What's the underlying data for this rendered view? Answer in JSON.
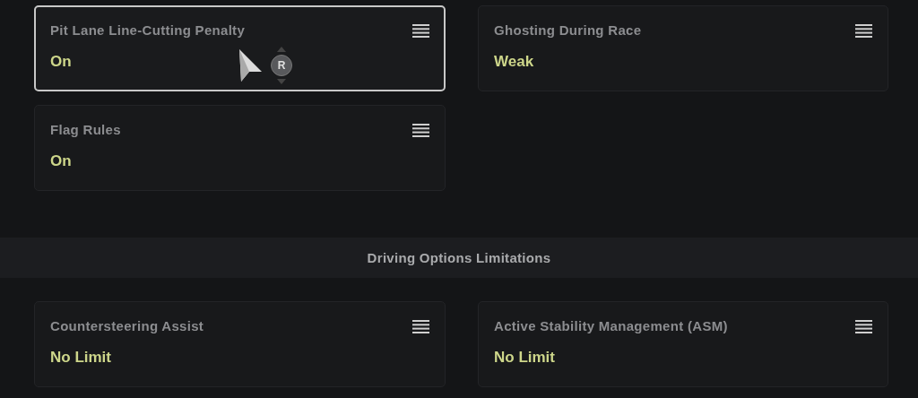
{
  "sections": [
    {
      "options": [
        {
          "label": "Pit Lane Line-Cutting Penalty",
          "value": "On",
          "selected": true
        },
        {
          "label": "Ghosting During Race",
          "value": "Weak",
          "selected": false
        },
        {
          "label": "Flag Rules",
          "value": "On",
          "selected": false
        }
      ]
    },
    {
      "heading": "Driving Options Limitations",
      "options": [
        {
          "label": "Countersteering Assist",
          "value": "No Limit",
          "selected": false
        },
        {
          "label": "Active Stability Management (ASM)",
          "value": "No Limit",
          "selected": false
        }
      ]
    }
  ],
  "cursor": {
    "button_label": "R"
  }
}
